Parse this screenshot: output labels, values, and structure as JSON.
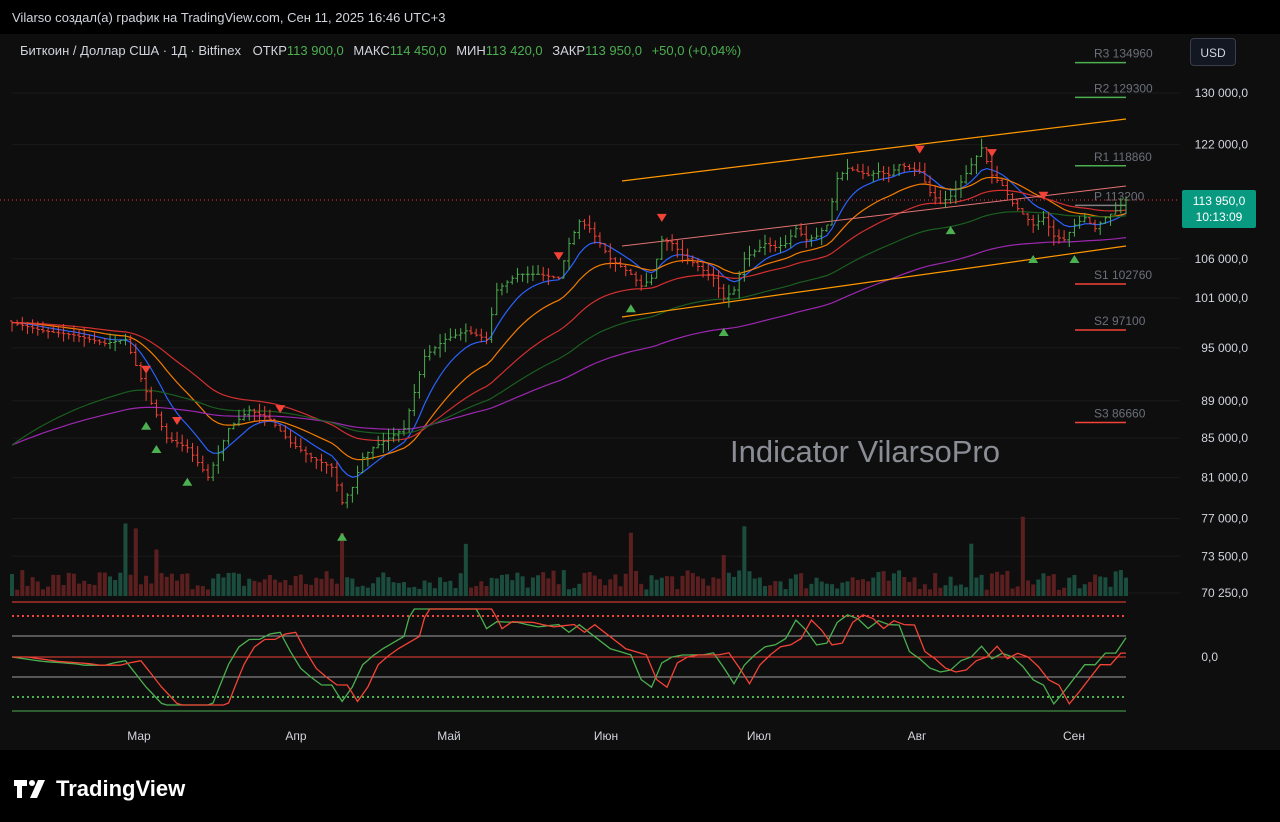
{
  "header": {
    "caption": "Vilarso создал(а) график на TradingView.com, Сен 11, 2025 16:46 UTC+3"
  },
  "legend": {
    "symbol": "Биткоин / Доллар США · 1Д · Bitfinex",
    "open_label": "ОТКР",
    "open_value": "113 900,0",
    "high_label": "МАКС",
    "high_value": "114 450,0",
    "low_label": "МИН",
    "low_value": "113 420,0",
    "close_label": "ЗАКР",
    "close_value": "113 950,0",
    "change": "+50,0 (+0,04%)"
  },
  "currency_button": "USD",
  "last_price": {
    "value": "113 950,0",
    "countdown": "10:13:09"
  },
  "watermark": "Indicator VilarsoPro",
  "oscillator": {
    "zero_label": "0,0"
  },
  "footer": {
    "brand": "TradingView"
  },
  "colors": {
    "up": "#4caf50",
    "down": "#f44336",
    "ema_fast": "#2962ff",
    "ema_mid": "#f57c00",
    "ema_slow": "#d32f2f",
    "ema_long": "#9c27b0",
    "sma_green": "#1b5e20",
    "channel": "#ff9800"
  },
  "chart_data": {
    "type": "candlestick",
    "x_ticks": [
      "Мар",
      "Апр",
      "Май",
      "Июн",
      "Июл",
      "Авг",
      "Сен"
    ],
    "y_ticks": [
      "130 000,0",
      "122 000,0",
      "106 000,0",
      "101 000,0",
      "95 000,0",
      "89 000,0",
      "85 000,0",
      "81 000,0",
      "77 000,0",
      "73 500,0",
      "70 250,0"
    ],
    "y_scale": "log",
    "pivot_levels": [
      {
        "name": "R3",
        "value": 134960,
        "label": "R3 134960"
      },
      {
        "name": "R2",
        "value": 129300,
        "label": "R2 129300"
      },
      {
        "name": "R1",
        "value": 118860,
        "label": "R1 118860"
      },
      {
        "name": "P",
        "value": 113200,
        "label": "P 113200"
      },
      {
        "name": "S1",
        "value": 102760,
        "label": "S1 102760"
      },
      {
        "name": "S2",
        "value": 97100,
        "label": "S2 97100"
      },
      {
        "name": "S3",
        "value": 86660,
        "label": "S3 86660"
      }
    ],
    "last_close": 113950,
    "price_path": [
      [
        0,
        98000
      ],
      [
        6,
        97000
      ],
      [
        12,
        96500
      ],
      [
        18,
        95500
      ],
      [
        22,
        96000
      ],
      [
        26,
        90000
      ],
      [
        30,
        85000
      ],
      [
        34,
        84000
      ],
      [
        38,
        81000
      ],
      [
        42,
        86000
      ],
      [
        46,
        88000
      ],
      [
        50,
        87000
      ],
      [
        54,
        84500
      ],
      [
        58,
        83000
      ],
      [
        62,
        82000
      ],
      [
        64,
        78500
      ],
      [
        66,
        80000
      ],
      [
        68,
        83000
      ],
      [
        70,
        84000
      ],
      [
        73,
        85000
      ],
      [
        76,
        86000
      ],
      [
        80,
        94000
      ],
      [
        84,
        96000
      ],
      [
        88,
        97000
      ],
      [
        92,
        96000
      ],
      [
        94,
        102000
      ],
      [
        98,
        104000
      ],
      [
        102,
        104000
      ],
      [
        106,
        103500
      ],
      [
        108,
        108000
      ],
      [
        110,
        111000
      ],
      [
        112,
        110000
      ],
      [
        114,
        108000
      ],
      [
        116,
        106000
      ],
      [
        118,
        105000
      ],
      [
        120,
        104000
      ],
      [
        122,
        102500
      ],
      [
        124,
        103500
      ],
      [
        126,
        108500
      ],
      [
        128,
        108000
      ],
      [
        130,
        106500
      ],
      [
        132,
        105500
      ],
      [
        134,
        104500
      ],
      [
        136,
        103500
      ],
      [
        138,
        101000
      ],
      [
        140,
        102000
      ],
      [
        142,
        106000
      ],
      [
        144,
        107000
      ],
      [
        146,
        108000
      ],
      [
        148,
        107500
      ],
      [
        150,
        108000
      ],
      [
        152,
        110000
      ],
      [
        154,
        108500
      ],
      [
        156,
        109000
      ],
      [
        158,
        110500
      ],
      [
        160,
        117000
      ],
      [
        162,
        118500
      ],
      [
        164,
        118000
      ],
      [
        166,
        117500
      ],
      [
        168,
        118000
      ],
      [
        170,
        117500
      ],
      [
        172,
        119000
      ],
      [
        174,
        118500
      ],
      [
        176,
        118000
      ],
      [
        178,
        115000
      ],
      [
        180,
        113500
      ],
      [
        182,
        114500
      ],
      [
        184,
        116500
      ],
      [
        186,
        119000
      ],
      [
        188,
        121500
      ],
      [
        190,
        117500
      ],
      [
        192,
        116000
      ],
      [
        194,
        113500
      ],
      [
        196,
        112000
      ],
      [
        198,
        110500
      ],
      [
        200,
        111500
      ],
      [
        202,
        109000
      ],
      [
        204,
        108500
      ],
      [
        206,
        110500
      ],
      [
        208,
        111500
      ],
      [
        210,
        110000
      ],
      [
        212,
        111500
      ],
      [
        214,
        112500
      ],
      [
        216,
        113950
      ]
    ],
    "oscillator_min": -1,
    "oscillator_max": 1
  }
}
